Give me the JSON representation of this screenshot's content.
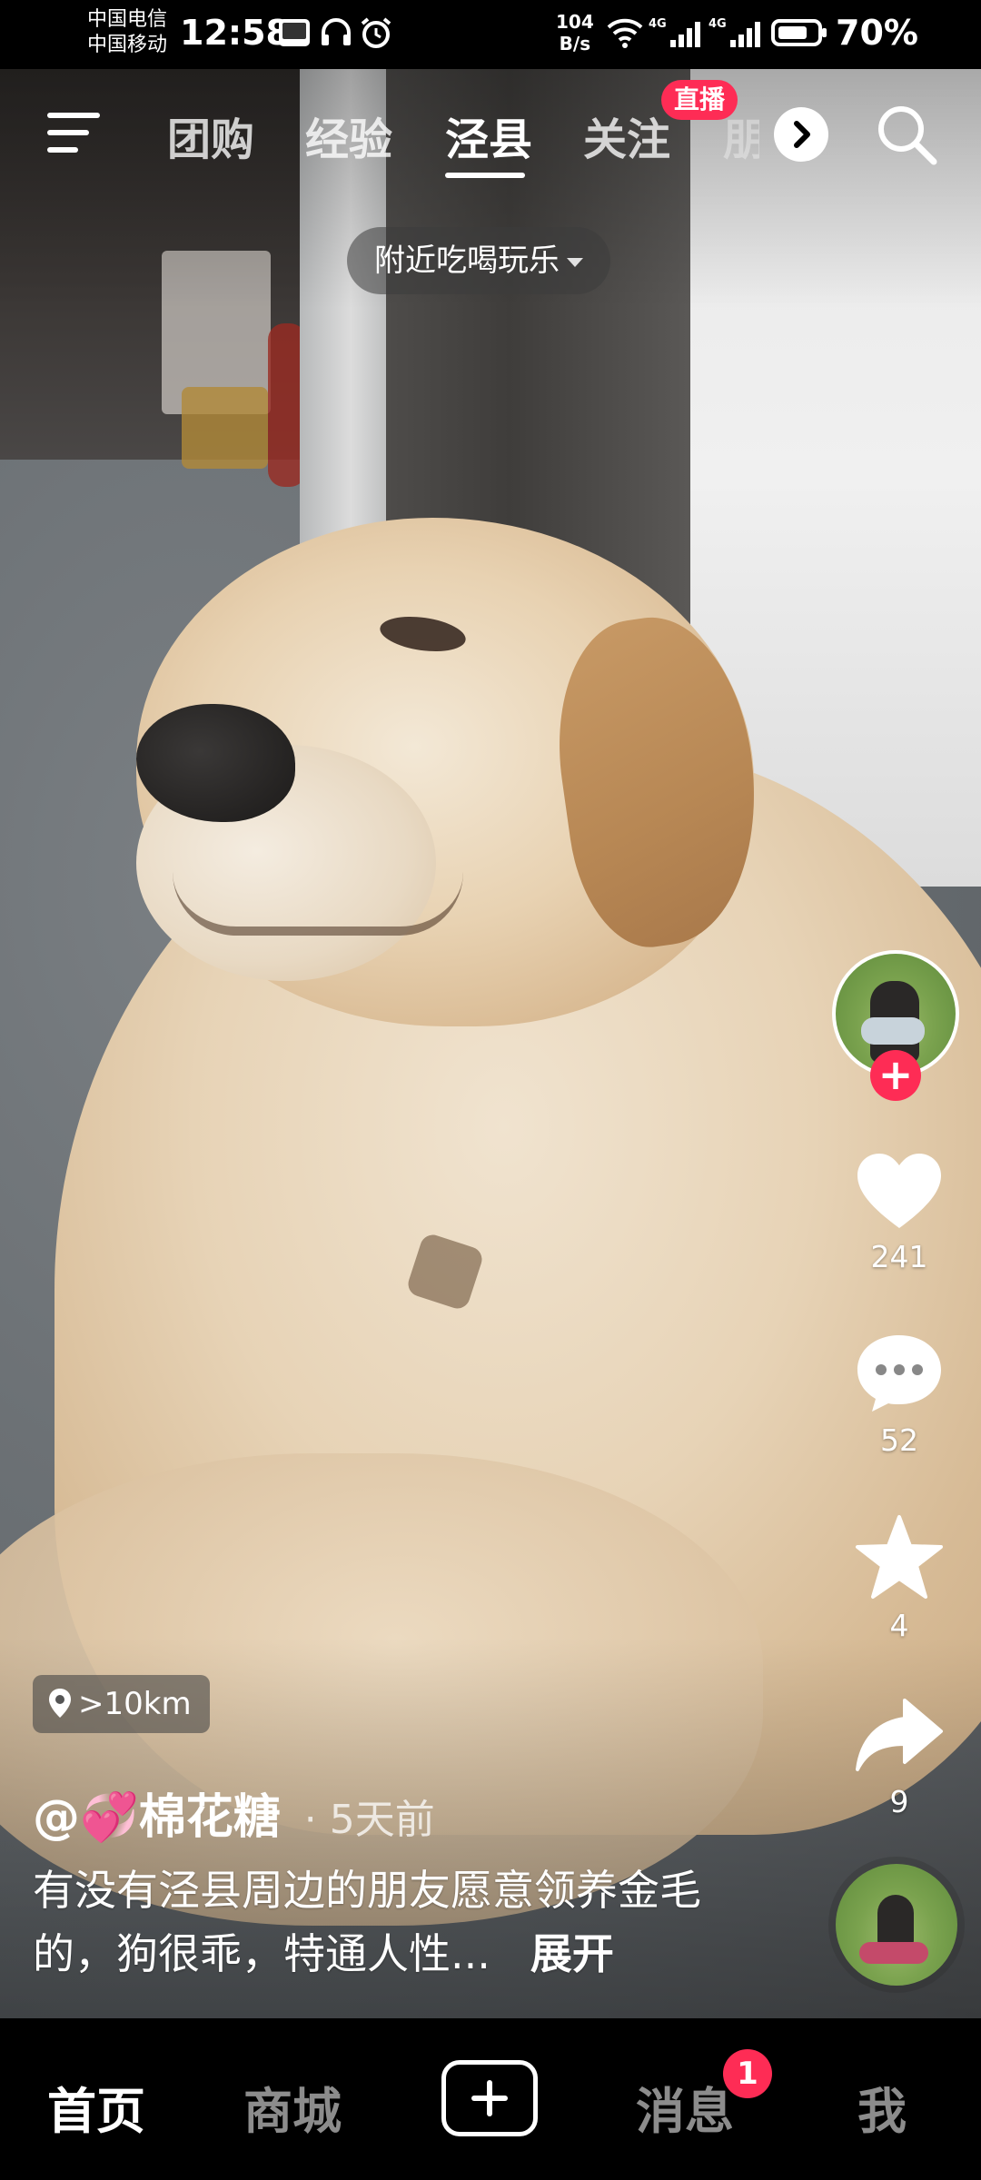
{
  "status_bar": {
    "carrier_1": "中国电信",
    "carrier_2": "中国移动",
    "time": "12:58",
    "net_speed_value": "104",
    "net_speed_unit": "B/s",
    "network_1": "4G",
    "network_2": "4G",
    "battery": "70%"
  },
  "top_nav": {
    "tabs": [
      {
        "label": "团购",
        "active": false
      },
      {
        "label": "经验",
        "active": false
      },
      {
        "label": "泾县",
        "active": true
      },
      {
        "label": "关注",
        "active": false
      },
      {
        "label": "朋",
        "active": false
      }
    ],
    "live_badge": "直播",
    "location_filter": "附近吃喝玩乐"
  },
  "video": {
    "distance": ">10km",
    "author": "@💞棉花糖",
    "post_time": "· 5天前",
    "caption": "有没有泾县周边的朋友愿意领养金毛的，狗很乖，特通人性...",
    "expand_label": "展开"
  },
  "actions": {
    "likes": "241",
    "comments": "52",
    "favorites": "4",
    "shares": "9"
  },
  "bottom_nav": {
    "items": [
      {
        "label": "首页",
        "active": true
      },
      {
        "label": "商城",
        "active": false
      },
      {
        "label": "消息",
        "active": false
      },
      {
        "label": "我",
        "active": false
      }
    ],
    "message_badge": "1"
  },
  "colors": {
    "accent": "#fe2c55",
    "background": "#000000",
    "text": "#ffffff"
  },
  "icons": [
    "menu-icon",
    "search-icon",
    "chevron-right-icon",
    "location-pin-icon",
    "heart-icon",
    "comment-icon",
    "star-icon",
    "share-icon",
    "plus-icon",
    "wifi-icon",
    "signal-icon",
    "battery-icon",
    "headphones-icon",
    "alarm-icon"
  ]
}
